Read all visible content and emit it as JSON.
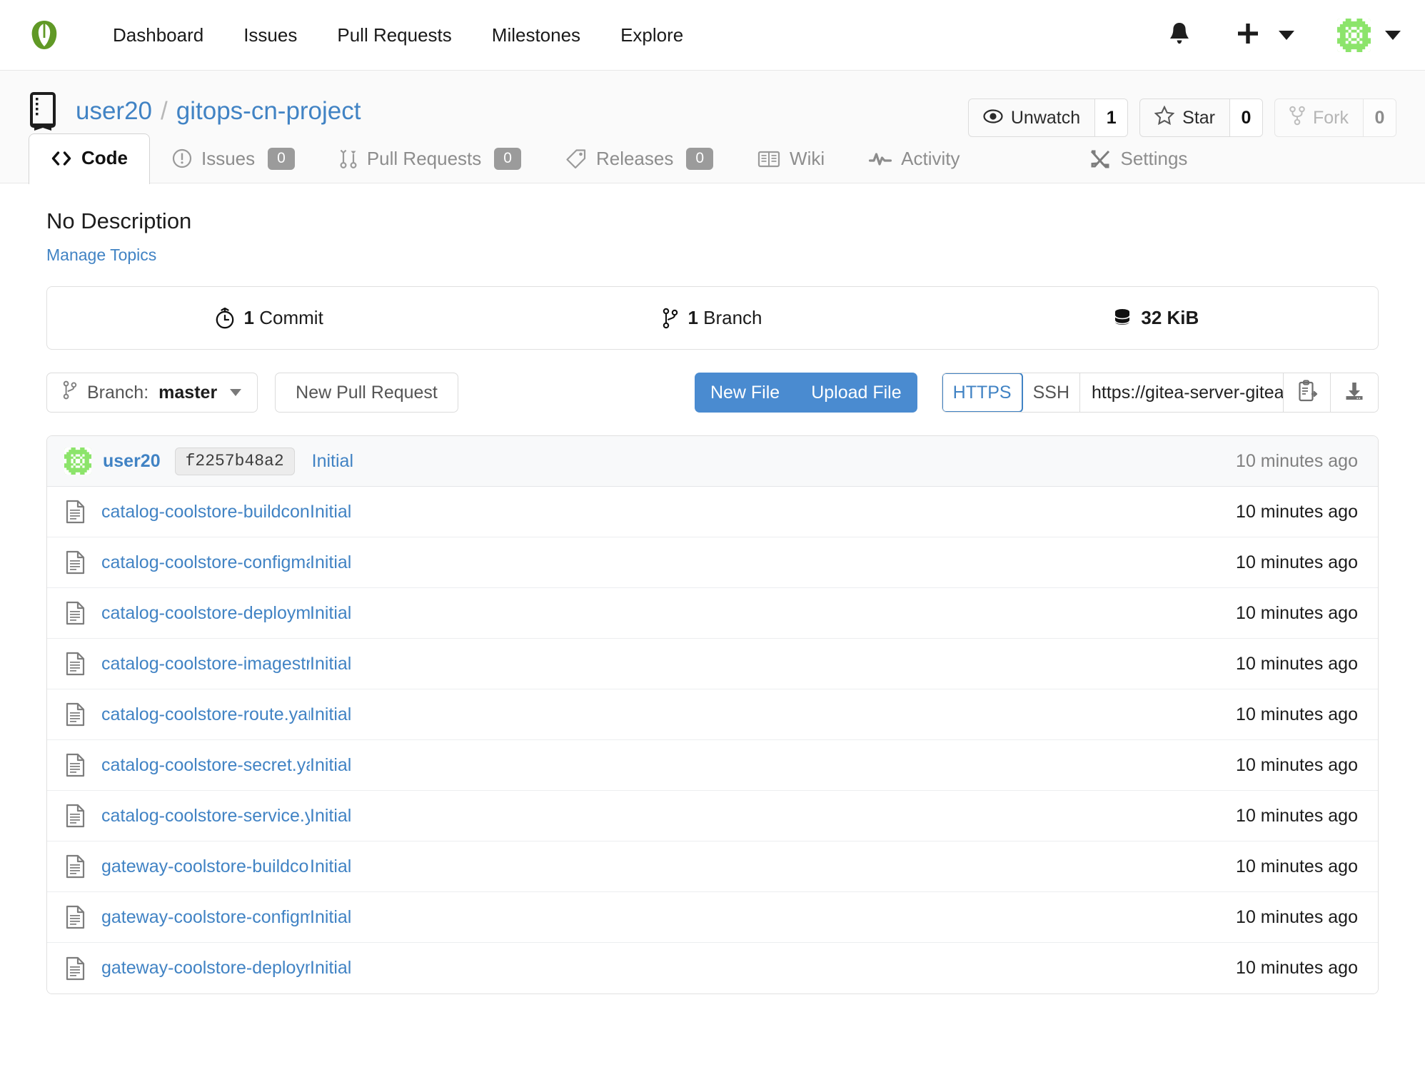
{
  "navbar": {
    "logo_icon": "gitea-leaf-logo",
    "links": [
      {
        "label": "Dashboard",
        "name": "nav-link-dashboard"
      },
      {
        "label": "Issues",
        "name": "nav-link-issues"
      },
      {
        "label": "Pull Requests",
        "name": "nav-link-pull-requests"
      },
      {
        "label": "Milestones",
        "name": "nav-link-milestones"
      },
      {
        "label": "Explore",
        "name": "nav-link-explore"
      }
    ],
    "bell_icon": "bell-icon",
    "plus_icon": "plus-icon",
    "create_caret_icon": "chevron-down-icon",
    "avatar_icon": "user-avatar-identicon",
    "user_caret_icon": "chevron-down-icon"
  },
  "repo": {
    "icon": "repo-book-icon",
    "owner": "user20",
    "separator": "/",
    "name": "gitops-cn-project",
    "actions": {
      "watch_label": "Unwatch",
      "watch_count": "1",
      "watch_icon": "eye-icon",
      "star_label": "Star",
      "star_count": "0",
      "star_icon": "star-icon",
      "fork_label": "Fork",
      "fork_count": "0",
      "fork_icon": "fork-icon"
    }
  },
  "tabs": [
    {
      "label": "Code",
      "icon": "code-brackets-icon",
      "badge": null,
      "active": true,
      "name": "tab-code"
    },
    {
      "label": "Issues",
      "icon": "issue-exclamation-icon",
      "badge": "0",
      "active": false,
      "name": "tab-issues"
    },
    {
      "label": "Pull Requests",
      "icon": "pull-request-icon",
      "badge": "0",
      "active": false,
      "name": "tab-pull-requests"
    },
    {
      "label": "Releases",
      "icon": "tag-icon",
      "badge": "0",
      "active": false,
      "name": "tab-releases"
    },
    {
      "label": "Wiki",
      "icon": "book-icon",
      "badge": null,
      "active": false,
      "name": "tab-wiki"
    },
    {
      "label": "Activity",
      "icon": "pulse-icon",
      "badge": null,
      "active": false,
      "name": "tab-activity"
    },
    {
      "label": "Settings",
      "icon": "tools-icon",
      "badge": null,
      "active": false,
      "name": "tab-settings"
    }
  ],
  "description": {
    "text": "No Description",
    "manage_topics_label": "Manage Topics"
  },
  "stats": {
    "commits_count": "1",
    "commits_label": "Commit",
    "commits_icon": "clock-history-icon",
    "branches_count": "1",
    "branches_label": "Branch",
    "branches_icon": "branch-icon",
    "size_label": "32 KiB",
    "size_icon": "database-icon"
  },
  "toolbar": {
    "branch_prefix": "Branch:",
    "branch_name": "master",
    "branch_icon": "branch-icon",
    "branch_caret_icon": "chevron-down-icon",
    "new_pull_request_label": "New Pull Request",
    "new_file_label": "New File",
    "upload_file_label": "Upload File",
    "proto_https_label": "HTTPS",
    "proto_ssh_label": "SSH",
    "active_proto": "HTTPS",
    "clone_url": "https://gitea-server-gitea.apps.c",
    "copy_icon": "clipboard-paste-icon",
    "download_icon": "download-icon",
    "accent_color": "#4a8bd0",
    "link_color": "#4183c4"
  },
  "commit_header": {
    "avatar_icon": "user-avatar-identicon",
    "author": "user20",
    "sha": "f2257b48a2",
    "message": "Initial",
    "time": "10 minutes ago"
  },
  "files": [
    {
      "icon": "file-text-icon",
      "name": "catalog-coolstore-buildcon…",
      "commit_message": "Initial",
      "time": "10 minutes ago"
    },
    {
      "icon": "file-text-icon",
      "name": "catalog-coolstore-configma…",
      "commit_message": "Initial",
      "time": "10 minutes ago"
    },
    {
      "icon": "file-text-icon",
      "name": "catalog-coolstore-deploym…",
      "commit_message": "Initial",
      "time": "10 minutes ago"
    },
    {
      "icon": "file-text-icon",
      "name": "catalog-coolstore-imagestr…",
      "commit_message": "Initial",
      "time": "10 minutes ago"
    },
    {
      "icon": "file-text-icon",
      "name": "catalog-coolstore-route.yaml",
      "commit_message": "Initial",
      "time": "10 minutes ago"
    },
    {
      "icon": "file-text-icon",
      "name": "catalog-coolstore-secret.ya…",
      "commit_message": "Initial",
      "time": "10 minutes ago"
    },
    {
      "icon": "file-text-icon",
      "name": "catalog-coolstore-service.y…",
      "commit_message": "Initial",
      "time": "10 minutes ago"
    },
    {
      "icon": "file-text-icon",
      "name": "gateway-coolstore-buildcon…",
      "commit_message": "Initial",
      "time": "10 minutes ago"
    },
    {
      "icon": "file-text-icon",
      "name": "gateway-coolstore-configm…",
      "commit_message": "Initial",
      "time": "10 minutes ago"
    },
    {
      "icon": "file-text-icon",
      "name": "gateway-coolstore-deploym…",
      "commit_message": "Initial",
      "time": "10 minutes ago"
    }
  ]
}
